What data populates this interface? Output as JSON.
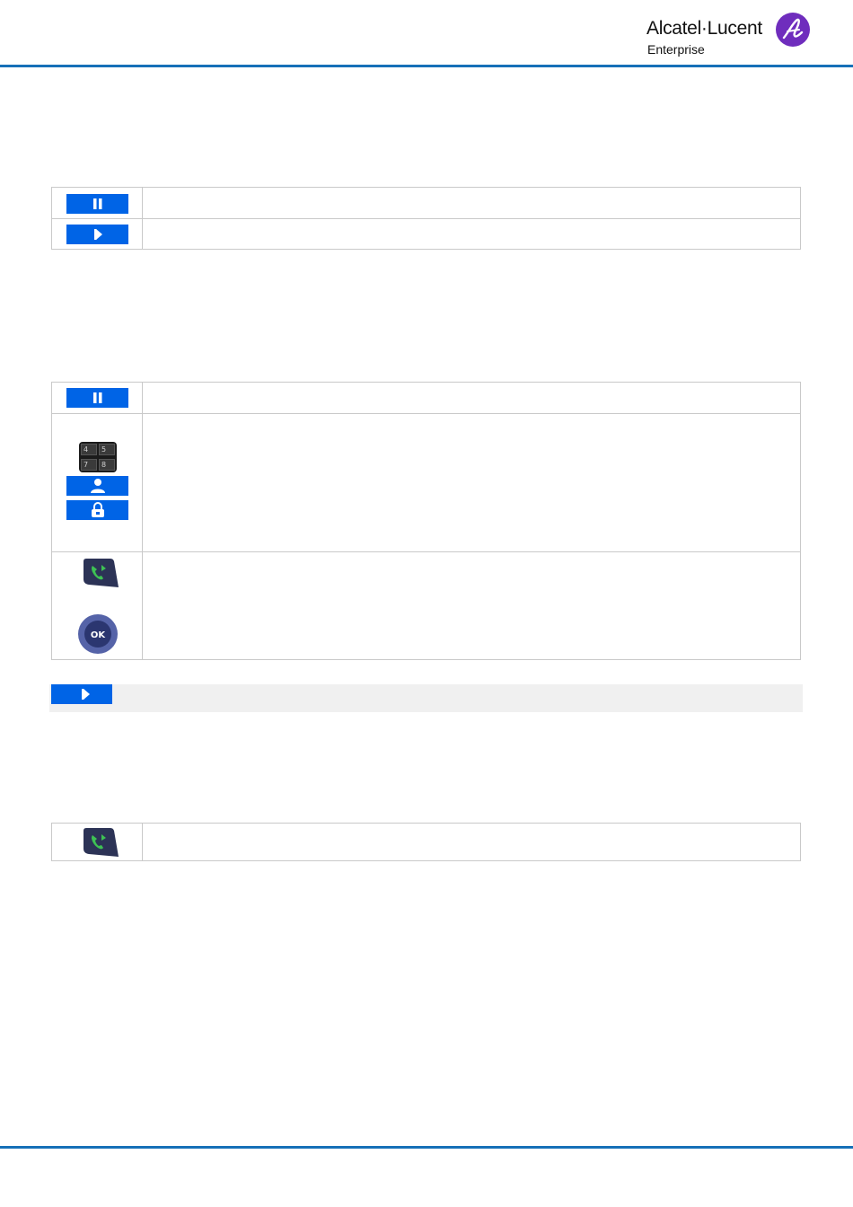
{
  "header": {
    "logo": {
      "brand_text": "Alcatel·Lucent",
      "sub_text": "Enterprise",
      "brand_color": "#6f2dbd"
    }
  },
  "accent_color": "#1670b8",
  "button_color": "#0064e6",
  "section_1": {
    "rows": [
      {
        "icon": "pause-softkey-icon"
      },
      {
        "icon": "next-arrow-softkey-icon"
      }
    ]
  },
  "section_2": {
    "rows": [
      {
        "icon": "pause-softkey-icon"
      },
      {
        "icons": [
          "dial-keypad-icon",
          "contact-person-softkey-icon",
          "lock-softkey-icon"
        ],
        "keypad_keys": [
          "4",
          "5",
          "7",
          "8"
        ]
      },
      {
        "icons": [
          "off-hook-call-key-icon",
          "ok-navigation-key-icon"
        ],
        "ok_label": "OK"
      }
    ]
  },
  "note": {
    "icon": "next-arrow-softkey-icon"
  },
  "section_3": {
    "rows": [
      {
        "icon": "off-hook-call-key-icon"
      }
    ]
  }
}
